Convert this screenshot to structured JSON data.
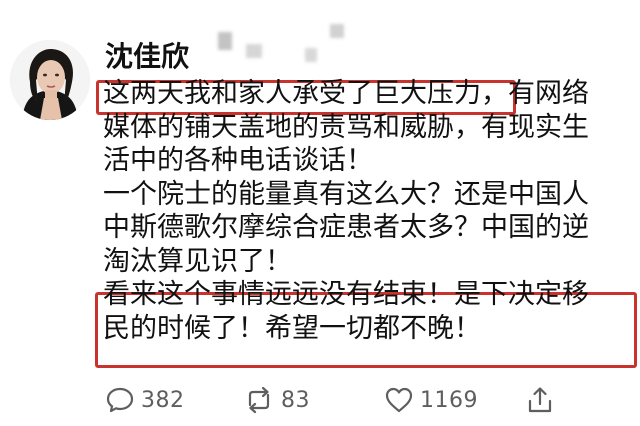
{
  "post": {
    "author": "沈佳欣",
    "lines": [
      {
        "pre": "",
        "highlight": "这两天我和家人承受了巨大压力",
        "post": "，有网络"
      },
      {
        "pre": "媒体的铺天盖地的责骂和威胁，有现实生",
        "highlight": "",
        "post": ""
      },
      {
        "pre": "活中的各种电话谈话！",
        "highlight": "",
        "post": ""
      },
      {
        "pre": "一个院士的能量真有这么大？还是中国人",
        "highlight": "",
        "post": ""
      },
      {
        "pre": "中斯德歌尔摩综合症患者太多？中国的逆",
        "highlight": "",
        "post": ""
      },
      {
        "pre": "淘汰算见识了！",
        "highlight": "",
        "post": ""
      },
      {
        "pre": "看来这个事情远远没有结束！是下决定移",
        "highlight": "",
        "post": ""
      },
      {
        "pre": "民的时候了！希望一切都不晚！",
        "highlight": "",
        "post": ""
      }
    ],
    "highlight_color": "#c8332e"
  },
  "actions": {
    "comment": {
      "icon": "comment-icon",
      "count": "382"
    },
    "repost": {
      "icon": "repost-icon",
      "count": "83"
    },
    "like": {
      "icon": "heart-icon",
      "count": "1169"
    },
    "share": {
      "icon": "share-icon"
    }
  }
}
